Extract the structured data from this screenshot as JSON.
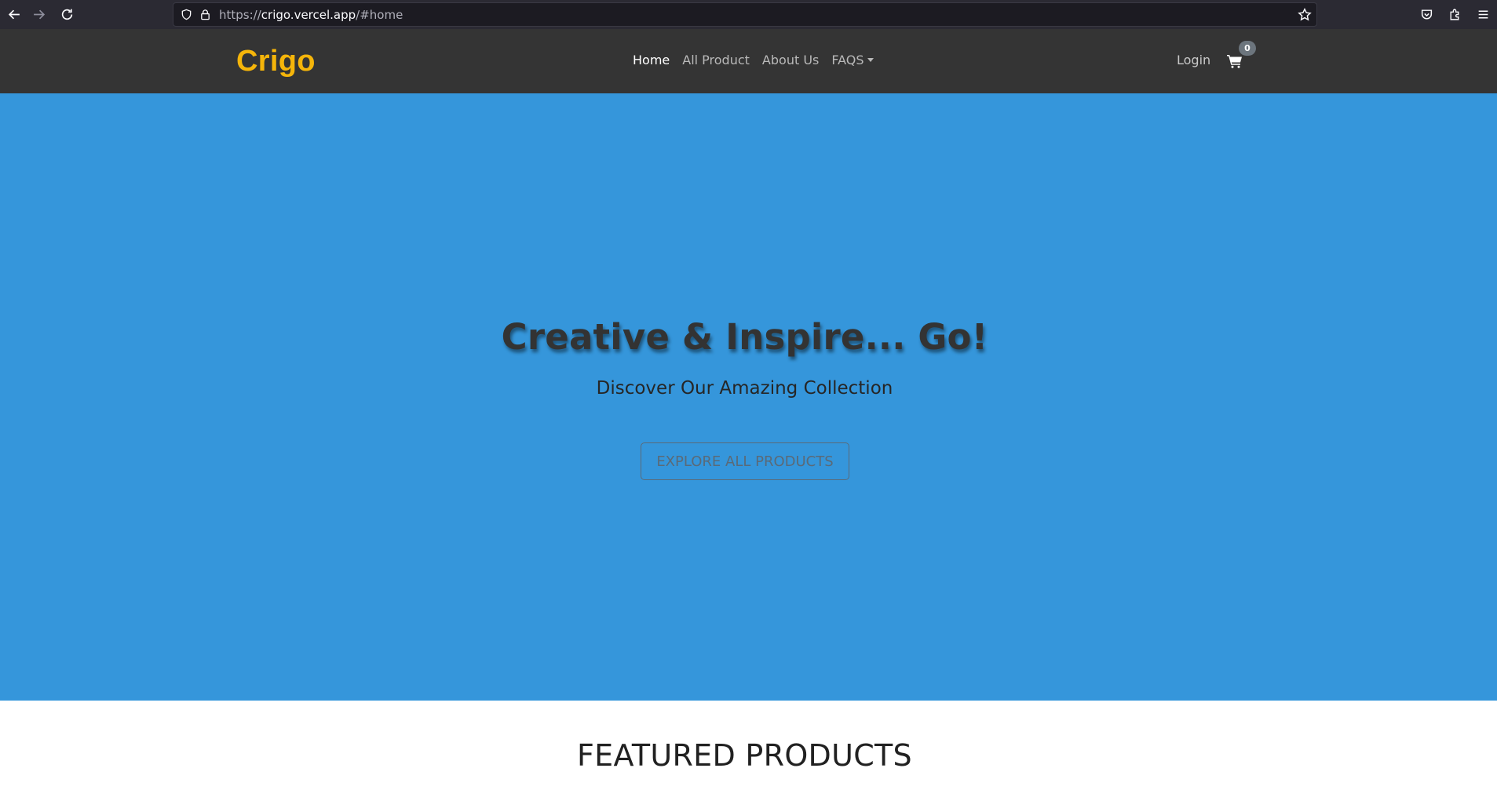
{
  "browser": {
    "url_prefix": "https://",
    "url_host": "crigo.vercel.app",
    "url_path": "/#home"
  },
  "nav": {
    "brand": "Crigo",
    "items": [
      {
        "label": "Home",
        "active": true
      },
      {
        "label": "All Product",
        "active": false
      },
      {
        "label": "About Us",
        "active": false
      },
      {
        "label": "FAQS",
        "active": false,
        "dropdown": true
      }
    ],
    "login": "Login",
    "cart_count": "0"
  },
  "hero": {
    "title": "Creative & Inspire... Go!",
    "subtitle": "Discover Our Amazing Collection",
    "button": "EXPLORE ALL PRODUCTS"
  },
  "featured": {
    "title": "FEATURED PRODUCTS"
  },
  "colors": {
    "hero_bg": "#3596db",
    "navbar_bg": "#343434",
    "brand": "#f5b50a"
  }
}
